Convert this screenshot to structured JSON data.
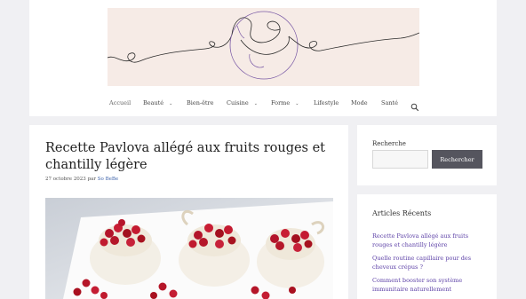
{
  "nav": {
    "items": [
      {
        "label": "Accueil",
        "has_dropdown": false
      },
      {
        "label": "Beauté",
        "has_dropdown": true
      },
      {
        "label": "Bien-être",
        "has_dropdown": false
      },
      {
        "label": "Cuisine",
        "has_dropdown": true
      },
      {
        "label": "Forme",
        "has_dropdown": true
      },
      {
        "label": "Lifestyle",
        "has_dropdown": false
      },
      {
        "label": "Mode",
        "has_dropdown": false
      },
      {
        "label": "Santé",
        "has_dropdown": false
      }
    ],
    "search_icon": "search-icon"
  },
  "post": {
    "title": "Recette Pavlova allégé aux fruits rouges et chantilly légère",
    "date": "27 octobre 2023",
    "by": "par",
    "author": "So BeBe"
  },
  "search_widget": {
    "label": "Recherche",
    "button_label": "Rechercher",
    "input_value": ""
  },
  "recent_widget": {
    "title": "Articles Récents",
    "items": [
      "Recette Pavlova allégé aux fruits rouges et chantilly légère",
      "Quelle routine capillaire pour des cheveux crépus ?",
      "Comment booster son système immunitaire naturellement"
    ]
  },
  "colors": {
    "page_bg": "#f0f0f3",
    "logo_bg": "#f6ebe6",
    "link": "#5b3fa6",
    "button_bg": "#55555e"
  }
}
